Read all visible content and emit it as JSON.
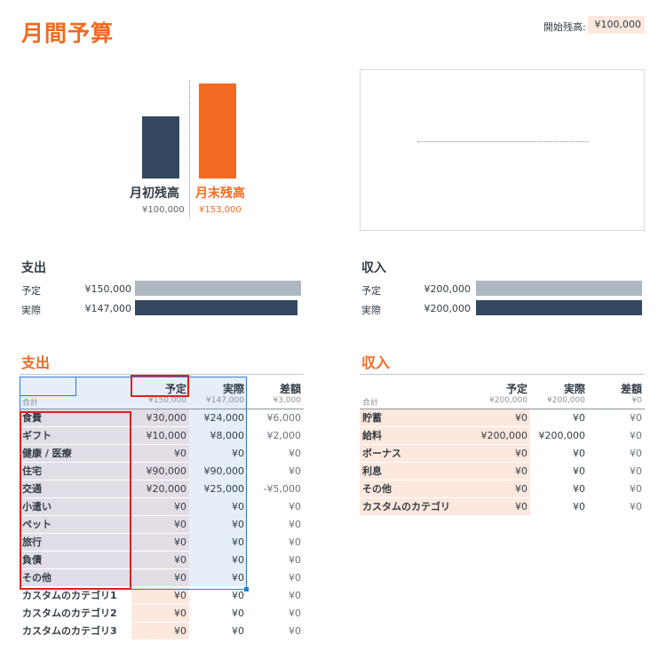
{
  "title": "月間予算",
  "start_balance": {
    "label": "開始残高:",
    "value": "¥100,000"
  },
  "balance_chart": {
    "left": {
      "label": "月初残高",
      "value": "¥100,000"
    },
    "right": {
      "label": "月末残高",
      "value": "¥153,000"
    }
  },
  "chart_data": {
    "type": "bar",
    "categories": [
      "月初残高",
      "月末残高"
    ],
    "values": [
      100000,
      153000
    ],
    "colors": [
      "#33475e",
      "#f26a21"
    ]
  },
  "expense_summary": {
    "title": "支出",
    "plan_label": "予定",
    "plan_value": "¥150,000",
    "actual_label": "実際",
    "actual_value": "¥147,000"
  },
  "income_summary": {
    "title": "収入",
    "plan_label": "予定",
    "plan_value": "¥200,000",
    "actual_label": "実際",
    "actual_value": "¥200,000"
  },
  "expenses": {
    "title": "支出",
    "headers": [
      "予定",
      "実際",
      "差額"
    ],
    "total_label": "合計",
    "totals": [
      "¥150,000",
      "¥147,000",
      "¥3,000"
    ],
    "rows": [
      {
        "cat": "食費",
        "plan": "¥30,000",
        "actual": "¥24,000",
        "diff": "¥6,000"
      },
      {
        "cat": "ギフト",
        "plan": "¥10,000",
        "actual": "¥8,000",
        "diff": "¥2,000"
      },
      {
        "cat": "健康 / 医療",
        "plan": "¥0",
        "actual": "¥0",
        "diff": "¥0"
      },
      {
        "cat": "住宅",
        "plan": "¥90,000",
        "actual": "¥90,000",
        "diff": "¥0"
      },
      {
        "cat": "交通",
        "plan": "¥20,000",
        "actual": "¥25,000",
        "diff": "-¥5,000"
      },
      {
        "cat": "小遣い",
        "plan": "¥0",
        "actual": "¥0",
        "diff": "¥0"
      },
      {
        "cat": "ペット",
        "plan": "¥0",
        "actual": "¥0",
        "diff": "¥0"
      },
      {
        "cat": "旅行",
        "plan": "¥0",
        "actual": "¥0",
        "diff": "¥0"
      },
      {
        "cat": "負債",
        "plan": "¥0",
        "actual": "¥0",
        "diff": "¥0"
      },
      {
        "cat": "その他",
        "plan": "¥0",
        "actual": "¥0",
        "diff": "¥0"
      },
      {
        "cat": "カスタムのカテゴリ1",
        "plan": "¥0",
        "actual": "¥0",
        "diff": "¥0"
      },
      {
        "cat": "カスタムのカテゴリ2",
        "plan": "¥0",
        "actual": "¥0",
        "diff": "¥0"
      },
      {
        "cat": "カスタムのカテゴリ3",
        "plan": "¥0",
        "actual": "¥0",
        "diff": "¥0"
      }
    ]
  },
  "income": {
    "title": "収入",
    "headers": [
      "予定",
      "実際",
      "差額"
    ],
    "total_label": "合計",
    "totals": [
      "¥200,000",
      "¥200,000",
      "¥0"
    ],
    "rows": [
      {
        "cat": "貯蓄",
        "plan": "¥0",
        "actual": "¥0",
        "diff": "¥0"
      },
      {
        "cat": "給料",
        "plan": "¥200,000",
        "actual": "¥200,000",
        "diff": "¥0"
      },
      {
        "cat": "ボーナス",
        "plan": "¥0",
        "actual": "¥0",
        "diff": "¥0"
      },
      {
        "cat": "利息",
        "plan": "¥0",
        "actual": "¥0",
        "diff": "¥0"
      },
      {
        "cat": "その他",
        "plan": "¥0",
        "actual": "¥0",
        "diff": "¥0"
      },
      {
        "cat": "カスタムのカテゴリ",
        "plan": "¥0",
        "actual": "¥0",
        "diff": "¥0"
      }
    ]
  }
}
